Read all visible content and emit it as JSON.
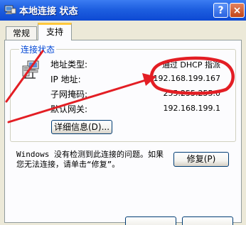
{
  "window": {
    "title": "本地连接 状态",
    "help_glyph": "?",
    "close_glyph": "×"
  },
  "tabs": [
    {
      "label": "常规",
      "selected": false
    },
    {
      "label": "支持",
      "selected": true
    }
  ],
  "connection_status": {
    "group_label": "连接状态",
    "rows": [
      {
        "label": "地址类型:",
        "value": "通过 DHCP 指派"
      },
      {
        "label": "IP 地址:",
        "value": "192.168.199.167"
      },
      {
        "label": "子网掩码:",
        "value": "255.255.255.0"
      },
      {
        "label": "默认网关:",
        "value": "192.168.199.1"
      }
    ],
    "details_button": "详细信息(D)..."
  },
  "repair": {
    "text_lines": [
      "Windows 没有检测到此连接的问题。如果",
      "您无法连接，请单击“修复”。"
    ],
    "button": "修复(P)"
  },
  "colors": {
    "title_bar": "#0E49D3",
    "annotation": "#E31E24",
    "group_label": "#0046D5",
    "tab_highlight": "#FFC83C"
  },
  "icons": {
    "title": "network-connection-icon",
    "status": "network-computer-icon"
  }
}
